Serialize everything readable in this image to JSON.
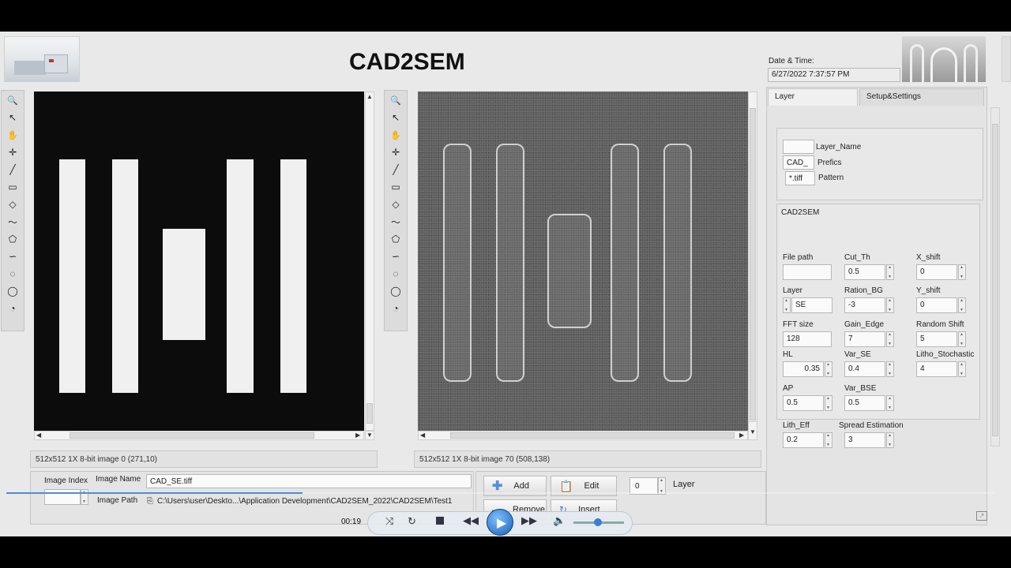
{
  "app": {
    "title": "CAD2SEM"
  },
  "datetime": {
    "label": "Date & Time:",
    "value": "6/27/2022 7:37:57 PM"
  },
  "left_view": {
    "status": "512x512 1X 8-bit image 0    (271,10)"
  },
  "right_view": {
    "status": "512x512 1X 8-bit image 70    (508,138)"
  },
  "tools": [
    "magnify-icon",
    "pointer-icon",
    "pan-hand-icon",
    "crosshair-icon",
    "line-icon",
    "rectangle-icon",
    "rotated-rect-icon",
    "polyline-icon",
    "polygon-icon",
    "freehand-line-icon",
    "freehand-region-icon",
    "oval-icon",
    "annulus-icon"
  ],
  "tabs": {
    "layer": "Layer",
    "setup": "Setup&Settings"
  },
  "layer_box": {
    "layer_name_label": "Layer_Name",
    "layer_name_value": "",
    "prefix_label": "Prefics",
    "prefix_value": "CAD_",
    "pattern_label": "Pattern",
    "pattern_value": "*.tiff"
  },
  "cad2sem": {
    "heading": "CAD2SEM",
    "file_path_label": "File path",
    "file_path_value": "",
    "layer_label": "Layer",
    "layer_value": "SE",
    "fft_label": "FFT size",
    "fft_value": "128",
    "hl_label": "HL",
    "hl_value": "0.35",
    "ap_label": "AP",
    "ap_value": "0.5",
    "lith_label": "Lith_Eff",
    "lith_value": "0.2",
    "cut_label": "Cut_Th",
    "cut_value": "0.5",
    "ration_label": "Ration_BG",
    "ration_value": "-3",
    "gain_label": "Gain_Edge",
    "gain_value": "7",
    "varse_label": "Var_SE",
    "varse_value": "0.4",
    "varbse_label": "Var_BSE",
    "varbse_value": "0.5",
    "spread_label": "Spread Estimation",
    "spread_value": "3",
    "xshift_label": "X_shift",
    "xshift_value": "0",
    "yshift_label": "Y_shift",
    "yshift_value": "0",
    "random_label": "Random Shift",
    "random_value": "5",
    "litho_label": "Litho_Stochastic",
    "litho_value": "4"
  },
  "bottom": {
    "image_index_label": "Image Index",
    "image_name_label": "Image Name",
    "image_name_value": "CAD_SE.tiff",
    "image_path_label": "Image Path",
    "image_path_value": "C:\\Users\\user\\Deskto...\\Application Development\\CAD2SEM_2022\\CAD2SEM\\Test1",
    "add_label": "Add",
    "edit_label": "Edit",
    "remove_label": "Remove",
    "insert_label": "Insert",
    "layer_label": "Layer",
    "layer_value": "0"
  },
  "player": {
    "time": "00:19",
    "progress": 0.3
  }
}
